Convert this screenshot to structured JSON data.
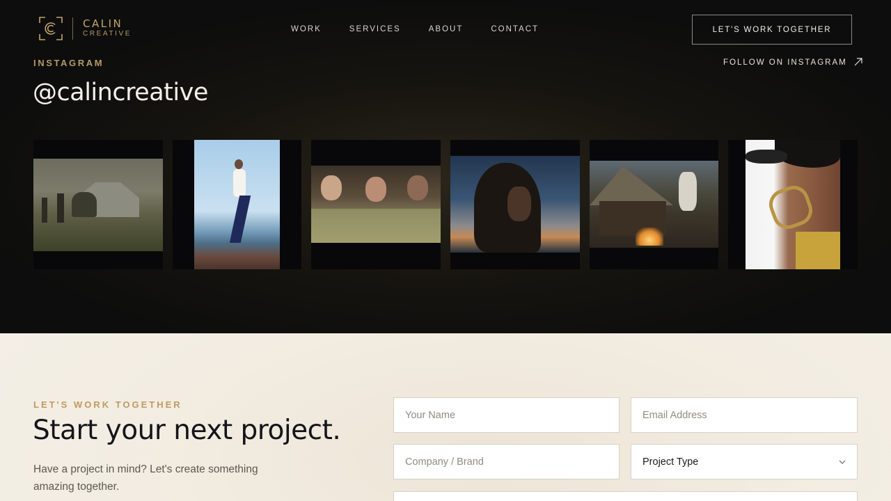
{
  "brand": {
    "name": "CALIN",
    "sub": "CREATIVE",
    "accent": "#c4a46a",
    "logo_icon": "camera-frame-c-icon"
  },
  "nav": {
    "items": [
      {
        "label": "WORK"
      },
      {
        "label": "SERVICES"
      },
      {
        "label": "ABOUT"
      },
      {
        "label": "CONTACT"
      }
    ],
    "cta": "LET'S WORK TOGETHER"
  },
  "instagram": {
    "eyebrow": "INSTAGRAM",
    "handle": "@calincreative",
    "follow_label": "FOLLOW ON INSTAGRAM",
    "follow_icon": "arrow-up-right-icon",
    "photos": [
      {
        "subject": "misty farmhouse with horse and figures"
      },
      {
        "subject": "man stepping on rocks by the sea"
      },
      {
        "subject": "women holding wildflowers"
      },
      {
        "subject": "windswept hair at sunset"
      },
      {
        "subject": "campfire by thatched log cabin"
      },
      {
        "subject": "profile with gold hoop earring"
      }
    ]
  },
  "contact": {
    "eyebrow": "LET'S WORK TOGETHER",
    "title": "Start your next project.",
    "description": "Have a project in mind? Let's create something amazing together.",
    "form": {
      "name_placeholder": "Your Name",
      "email_placeholder": "Email Address",
      "company_placeholder": "Company / Brand",
      "project_type_label": "Project Type",
      "project_type_icon": "chevron-down-icon"
    }
  }
}
